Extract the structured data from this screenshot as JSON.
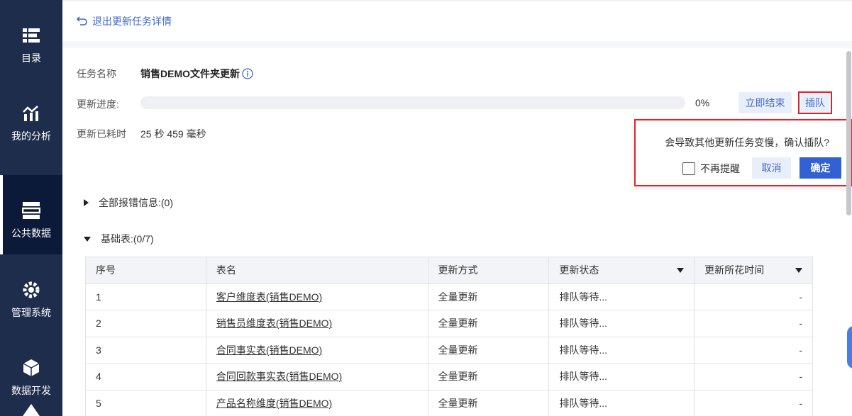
{
  "sidebar": {
    "items": [
      {
        "label": "目录",
        "icon": "catalog-icon"
      },
      {
        "label": "我的分析",
        "icon": "analysis-icon"
      },
      {
        "label": "公共数据",
        "icon": "public-data-icon",
        "active": true
      },
      {
        "label": "管理系统",
        "icon": "gear-icon"
      },
      {
        "label": "数据开发",
        "icon": "cube-icon"
      }
    ]
  },
  "header": {
    "back_label": "退出更新任务详情"
  },
  "task": {
    "name_label": "任务名称",
    "name": "销售DEMO文件夹更新",
    "progress_label": "更新进度:",
    "progress_value": 0,
    "progress_text": "0%",
    "end_button": "立即结束",
    "queue_button": "插队",
    "elapsed_label": "更新已耗时",
    "elapsed_value": "25 秒 459 毫秒"
  },
  "popconfirm": {
    "message": "会导致其他更新任务变慢，确认插队?",
    "checkbox_label": "不再提醒",
    "cancel": "取消",
    "ok": "确定"
  },
  "sections": {
    "errors": "全部报错信息:(0)",
    "base_tables": "基础表:(0/7)"
  },
  "table": {
    "headers": [
      "序号",
      "表名",
      "更新方式",
      "更新状态",
      "更新所花时间"
    ],
    "rows": [
      [
        "1",
        "客户维度表(销售DEMO)",
        "全量更新",
        "排队等待...",
        "-"
      ],
      [
        "2",
        "销售员维度表(销售DEMO)",
        "全量更新",
        "排队等待...",
        "-"
      ],
      [
        "3",
        "合同事实表(销售DEMO)",
        "全量更新",
        "排队等待...",
        "-"
      ],
      [
        "4",
        "合同回款事实表(销售DEMO)",
        "全量更新",
        "排队等待...",
        "-"
      ],
      [
        "5",
        "产品名称维度(销售DEMO)",
        "全量更新",
        "排队等待...",
        "-"
      ]
    ]
  },
  "colors": {
    "sidebar": "#1f2d4d",
    "accent": "#3f6ac9",
    "primary_button": "#3261d3",
    "highlight_border": "#e0232a"
  }
}
